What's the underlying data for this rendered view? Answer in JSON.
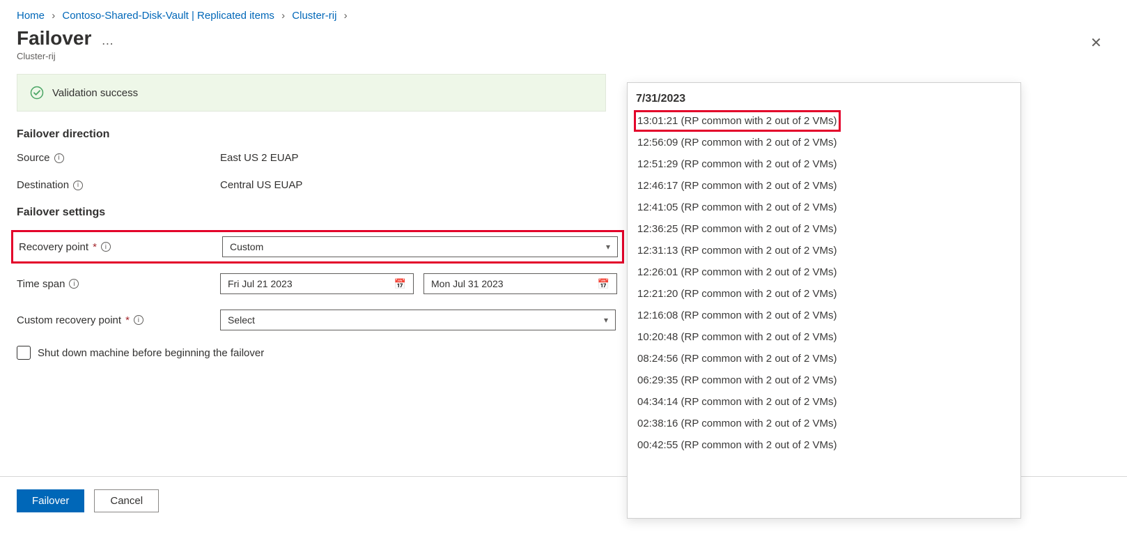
{
  "breadcrumb": {
    "home": "Home",
    "vault": "Contoso-Shared-Disk-Vault | Replicated items",
    "cluster": "Cluster-rij"
  },
  "header": {
    "title": "Failover",
    "subtitle": "Cluster-rij",
    "more_aria": "More"
  },
  "banner": {
    "text": "Validation success"
  },
  "sections": {
    "direction_heading": "Failover direction",
    "settings_heading": "Failover settings"
  },
  "fields": {
    "source_label": "Source",
    "source_value": "East US 2 EUAP",
    "destination_label": "Destination",
    "destination_value": "Central US EUAP",
    "recovery_point_label": "Recovery point",
    "recovery_point_value": "Custom",
    "time_span_label": "Time span",
    "time_span_from": "Fri Jul 21 2023",
    "time_span_to": "Mon Jul 31 2023",
    "custom_rp_label": "Custom recovery point",
    "custom_rp_value": "Select",
    "checkbox_label": "Shut down machine before beginning the failover"
  },
  "footer": {
    "primary": "Failover",
    "secondary": "Cancel"
  },
  "dropdown": {
    "date": "7/31/2023",
    "items": [
      "13:01:21 (RP common with 2 out of 2 VMs)",
      "12:56:09 (RP common with 2 out of 2 VMs)",
      "12:51:29 (RP common with 2 out of 2 VMs)",
      "12:46:17 (RP common with 2 out of 2 VMs)",
      "12:41:05 (RP common with 2 out of 2 VMs)",
      "12:36:25 (RP common with 2 out of 2 VMs)",
      "12:31:13 (RP common with 2 out of 2 VMs)",
      "12:26:01 (RP common with 2 out of 2 VMs)",
      "12:21:20 (RP common with 2 out of 2 VMs)",
      "12:16:08 (RP common with 2 out of 2 VMs)",
      "10:20:48 (RP common with 2 out of 2 VMs)",
      "08:24:56 (RP common with 2 out of 2 VMs)",
      "06:29:35 (RP common with 2 out of 2 VMs)",
      "04:34:14 (RP common with 2 out of 2 VMs)",
      "02:38:16 (RP common with 2 out of 2 VMs)",
      "00:42:55 (RP common with 2 out of 2 VMs)"
    ]
  }
}
